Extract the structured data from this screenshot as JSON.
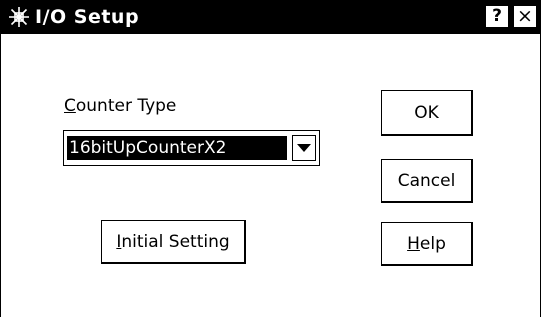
{
  "window": {
    "title": "I/O Setup",
    "help_button": "?",
    "close_button": "×"
  },
  "counter_type": {
    "label_accel": "C",
    "label_rest": "ounter Type",
    "selected_value": "16bitUpCounterX2"
  },
  "buttons": {
    "ok": "OK",
    "cancel": "Cancel",
    "help_accel": "H",
    "help_rest": "elp",
    "initial_accel": "I",
    "initial_rest": "nitial Setting"
  },
  "icons": {
    "title": "io-setup-icon",
    "dropdown": "chevron-down-icon"
  }
}
